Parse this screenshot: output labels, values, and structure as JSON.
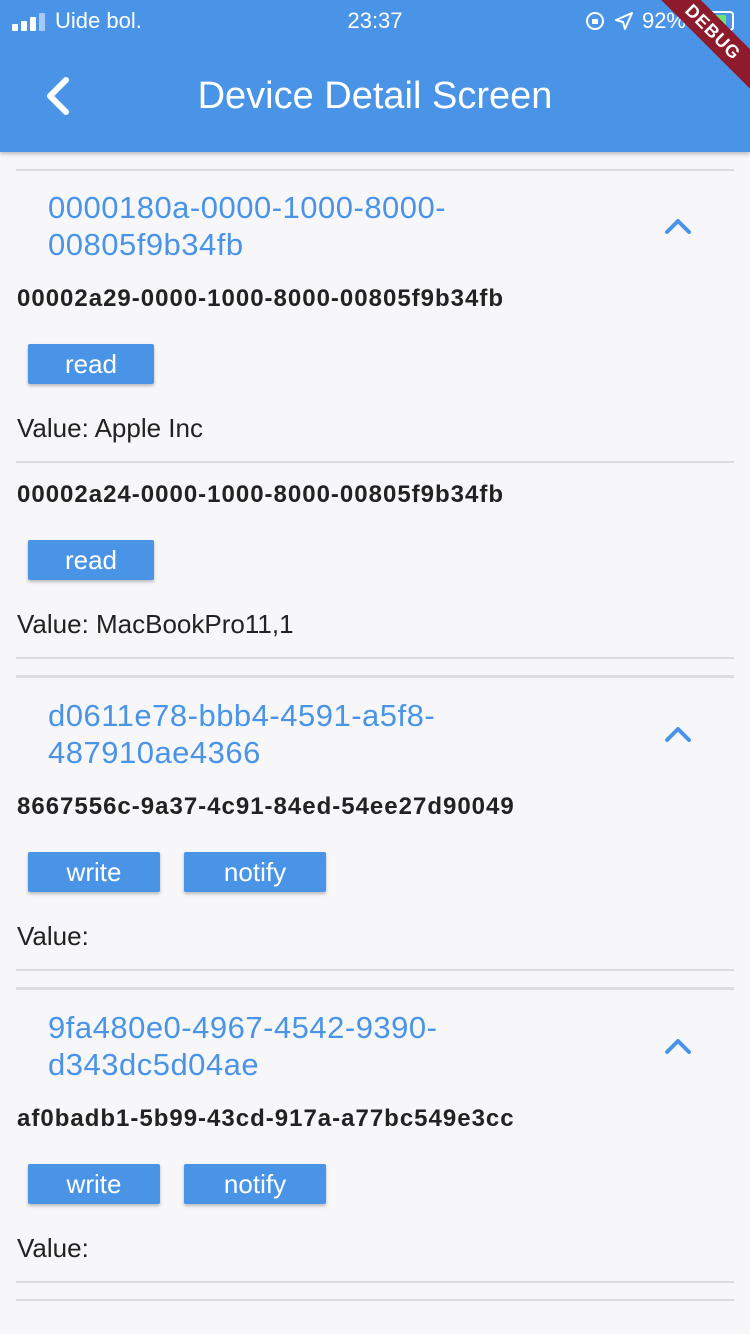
{
  "status_bar": {
    "carrier": "Uide bol.",
    "time": "23:37",
    "battery": "92%"
  },
  "app_bar": {
    "title": "Device Detail Screen",
    "debug_banner": "DEBUG",
    "color": "#4a94e8"
  },
  "services": [
    {
      "uuid": "0000180a-0000-1000-8000-00805f9b34fb",
      "characteristics": [
        {
          "uuid": "00002a29-0000-1000-8000-00805f9b34fb",
          "buttons": [
            "read"
          ],
          "value_label": "Value: Apple Inc"
        },
        {
          "uuid": "00002a24-0000-1000-8000-00805f9b34fb",
          "buttons": [
            "read"
          ],
          "value_label": "Value: MacBookPro11,1"
        }
      ]
    },
    {
      "uuid": "d0611e78-bbb4-4591-a5f8-487910ae4366",
      "characteristics": [
        {
          "uuid": "8667556c-9a37-4c91-84ed-54ee27d90049",
          "buttons": [
            "write",
            "notify"
          ],
          "value_label": "Value:"
        }
      ]
    },
    {
      "uuid": "9fa480e0-4967-4542-9390-d343dc5d04ae",
      "characteristics": [
        {
          "uuid": "af0badb1-5b99-43cd-917a-a77bc549e3cc",
          "buttons": [
            "write",
            "notify"
          ],
          "value_label": "Value:"
        }
      ]
    }
  ]
}
